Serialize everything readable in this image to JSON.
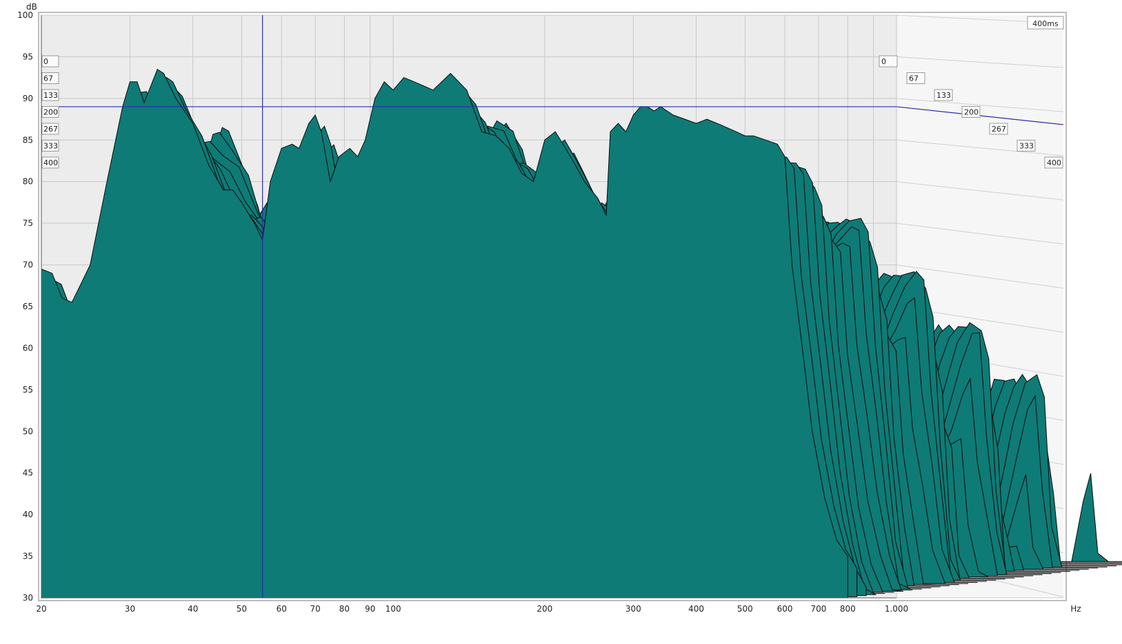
{
  "chart_data": {
    "type": "area",
    "subtype": "waterfall-3d",
    "y_unit": "dB",
    "x_unit": "Hz",
    "x_scale": "log",
    "xlim": [
      20,
      1000
    ],
    "ylim": [
      30,
      100
    ],
    "x_ticks": [
      {
        "value": 20,
        "label": "20"
      },
      {
        "value": 30,
        "label": "30"
      },
      {
        "value": 40,
        "label": "40"
      },
      {
        "value": 50,
        "label": "50"
      },
      {
        "value": 60,
        "label": "60"
      },
      {
        "value": 70,
        "label": "70"
      },
      {
        "value": 80,
        "label": "80"
      },
      {
        "value": 90,
        "label": "90"
      },
      {
        "value": 100,
        "label": "100"
      },
      {
        "value": 200,
        "label": "200"
      },
      {
        "value": 300,
        "label": "300"
      },
      {
        "value": 400,
        "label": "400"
      },
      {
        "value": 500,
        "label": "500"
      },
      {
        "value": 600,
        "label": "600"
      },
      {
        "value": 700,
        "label": "700"
      },
      {
        "value": 800,
        "label": "800"
      },
      {
        "value": 1000,
        "label": "1.000"
      }
    ],
    "y_ticks": [
      100,
      95,
      90,
      85,
      80,
      75,
      70,
      65,
      60,
      55,
      50,
      45,
      40,
      35,
      30
    ],
    "time_unit": "ms",
    "time_range_label": "400ms",
    "time_ticks": [
      "0",
      "67",
      "133",
      "200",
      "267",
      "333",
      "400"
    ],
    "grid": true,
    "cursor": {
      "freq": 55,
      "level_db": 89
    },
    "fill_color": "#0e7b76",
    "outline_color": "#0a0a0a",
    "slices": [
      {
        "t_ms": 0,
        "response": [
          [
            20,
            69.5
          ],
          [
            21,
            69
          ],
          [
            22,
            66
          ],
          [
            23,
            65.5
          ],
          [
            25,
            70
          ],
          [
            27,
            80
          ],
          [
            29,
            89
          ],
          [
            30,
            92
          ],
          [
            31,
            92
          ],
          [
            32,
            89.5
          ],
          [
            33,
            91.5
          ],
          [
            34,
            93.5
          ],
          [
            35,
            93
          ],
          [
            37,
            90
          ],
          [
            40,
            87
          ],
          [
            43,
            82
          ],
          [
            46,
            79
          ],
          [
            48,
            79
          ],
          [
            50,
            77.5
          ],
          [
            53,
            75
          ],
          [
            55,
            73
          ],
          [
            57,
            80
          ],
          [
            60,
            84
          ],
          [
            63,
            84.5
          ],
          [
            65,
            84
          ],
          [
            68,
            87
          ],
          [
            70,
            88
          ],
          [
            72,
            86
          ],
          [
            75,
            80
          ],
          [
            78,
            83
          ],
          [
            82,
            84
          ],
          [
            85,
            83
          ],
          [
            88,
            85
          ],
          [
            92,
            90
          ],
          [
            96,
            92
          ],
          [
            100,
            91
          ],
          [
            105,
            92.5
          ],
          [
            110,
            92
          ],
          [
            115,
            91.5
          ],
          [
            120,
            91
          ],
          [
            130,
            93
          ],
          [
            140,
            91
          ],
          [
            150,
            86
          ],
          [
            160,
            85.5
          ],
          [
            170,
            84
          ],
          [
            180,
            81
          ],
          [
            190,
            80
          ],
          [
            200,
            85
          ],
          [
            210,
            86
          ],
          [
            220,
            84
          ],
          [
            230,
            82
          ],
          [
            240,
            80
          ],
          [
            255,
            78
          ],
          [
            265,
            76
          ],
          [
            270,
            86
          ],
          [
            280,
            87
          ],
          [
            290,
            86
          ],
          [
            300,
            88
          ],
          [
            310,
            89
          ],
          [
            320,
            89
          ],
          [
            330,
            88.5
          ],
          [
            340,
            89
          ],
          [
            350,
            88.5
          ],
          [
            360,
            88
          ],
          [
            380,
            87.5
          ],
          [
            400,
            87
          ],
          [
            420,
            87.5
          ],
          [
            440,
            87
          ],
          [
            460,
            86.5
          ],
          [
            480,
            86
          ],
          [
            500,
            85.5
          ],
          [
            520,
            85.5
          ],
          [
            550,
            85
          ],
          [
            580,
            84.5
          ],
          [
            600,
            83
          ],
          [
            620,
            70
          ],
          [
            650,
            60
          ],
          [
            680,
            50
          ],
          [
            720,
            42
          ],
          [
            760,
            37
          ],
          [
            800,
            35
          ]
        ]
      }
    ],
    "slice_decay_db_per_step": 1.6,
    "slice_count": 34
  }
}
